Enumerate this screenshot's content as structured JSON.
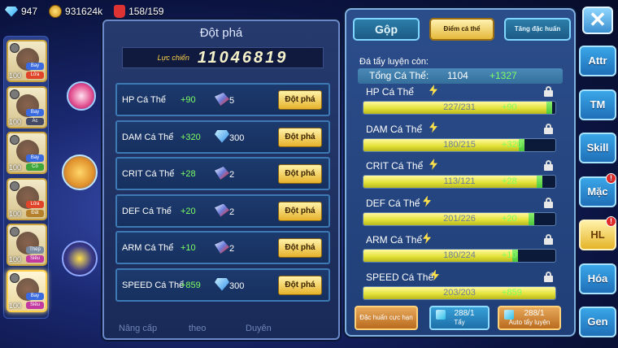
{
  "resources": {
    "gems": "947",
    "gold": "931624k",
    "bag": "158/159"
  },
  "pokemon_list": [
    {
      "level": "100",
      "types": [
        "Bay",
        "Lửa"
      ],
      "type_colors": [
        "#3a6ae0",
        "#e0452a"
      ],
      "selected": false
    },
    {
      "level": "100",
      "types": [
        "Bay",
        "Ác"
      ],
      "type_colors": [
        "#3a6ae0",
        "#444a66"
      ],
      "selected": false
    },
    {
      "level": "100",
      "types": [
        "Bay",
        "Cỏ"
      ],
      "type_colors": [
        "#3a6ae0",
        "#3fa73a"
      ],
      "selected": false
    },
    {
      "level": "100",
      "types": [
        "Lửa",
        "Đất"
      ],
      "type_colors": [
        "#e0452a",
        "#b5802c"
      ],
      "selected": false
    },
    {
      "level": "100",
      "types": [
        "Thép",
        "Siêu"
      ],
      "type_colors": [
        "#7a8aa0",
        "#c23aa0"
      ],
      "selected": false
    },
    {
      "level": "100",
      "types": [
        "Bay",
        "Siêu"
      ],
      "type_colors": [
        "#3a6ae0",
        "#c23aa0"
      ],
      "selected": true
    }
  ],
  "breakthrough": {
    "title": "Đột phá",
    "power_label": "Lực chiến",
    "power_value": "11046819",
    "rows": [
      {
        "name": "HP Cá Thể",
        "bonus": "+90",
        "icon": "ore-icon",
        "cost": "5",
        "button": "Đột phá"
      },
      {
        "name": "DAM Cá Thể",
        "bonus": "+320",
        "icon": "crystal-icon",
        "cost": "300",
        "button": "Đột phá"
      },
      {
        "name": "CRIT Cá Thể",
        "bonus": "+28",
        "icon": "ore-icon",
        "cost": "2",
        "button": "Đột phá"
      },
      {
        "name": "DEF Cá Thể",
        "bonus": "+20",
        "icon": "ore-icon",
        "cost": "2",
        "button": "Đột phá"
      },
      {
        "name": "ARM Cá Thể",
        "bonus": "+10",
        "icon": "ore-icon",
        "cost": "2",
        "button": "Đột phá"
      },
      {
        "name": "SPEED Cá Thể",
        "bonus": "+859",
        "icon": "crystal-icon",
        "cost": "300",
        "button": "Đột phá"
      }
    ],
    "ghost_labels": [
      "Nâng cấp",
      "theo",
      "Duyên"
    ]
  },
  "training": {
    "tabs": [
      "Gộp",
      "Điểm cá thể",
      "Tăng đặc huấn"
    ],
    "remaining_label": "Đá tẩy luyện còn:",
    "total_label": "Tổng Cá Thể:",
    "total_value": "1104",
    "total_bonus": "+1327",
    "stats": [
      {
        "name": "HP Cá Thể",
        "value": "227/231",
        "current": 227,
        "max": 231,
        "bonus": "+90"
      },
      {
        "name": "DAM Cá Thể",
        "value": "180/215",
        "current": 180,
        "max": 215,
        "bonus": "+320"
      },
      {
        "name": "CRIT Cá Thể",
        "value": "113/121",
        "current": 113,
        "max": 121,
        "bonus": "+28"
      },
      {
        "name": "DEF Cá Thể",
        "value": "201/226",
        "current": 201,
        "max": 226,
        "bonus": "+20"
      },
      {
        "name": "ARM Cá Thể",
        "value": "180/224",
        "current": 180,
        "max": 224,
        "bonus": "+10"
      },
      {
        "name": "SPEED Cá Thể",
        "value": "203/203",
        "current": 203,
        "max": 203,
        "bonus": "+859"
      }
    ],
    "buttons": {
      "special": "Đặc huấn cực hạn",
      "wash_count": "288/1",
      "wash": "Tẩy",
      "auto_count": "288/1",
      "auto": "Auto tẩy luyện"
    }
  },
  "nav": {
    "close": "✕",
    "items": [
      {
        "label": "Attr",
        "badge": false,
        "active": false
      },
      {
        "label": "TM",
        "badge": false,
        "active": false
      },
      {
        "label": "Skill",
        "badge": false,
        "active": false
      },
      {
        "label": "Mặc",
        "badge": true,
        "active": false
      },
      {
        "label": "HL",
        "badge": true,
        "active": true
      },
      {
        "label": "Hóa",
        "badge": false,
        "active": false
      },
      {
        "label": "Gen",
        "badge": false,
        "active": false
      }
    ]
  },
  "colors": {
    "accent": "#7dff62",
    "button_gold": "#e6b22c",
    "panel": "#203f78"
  }
}
